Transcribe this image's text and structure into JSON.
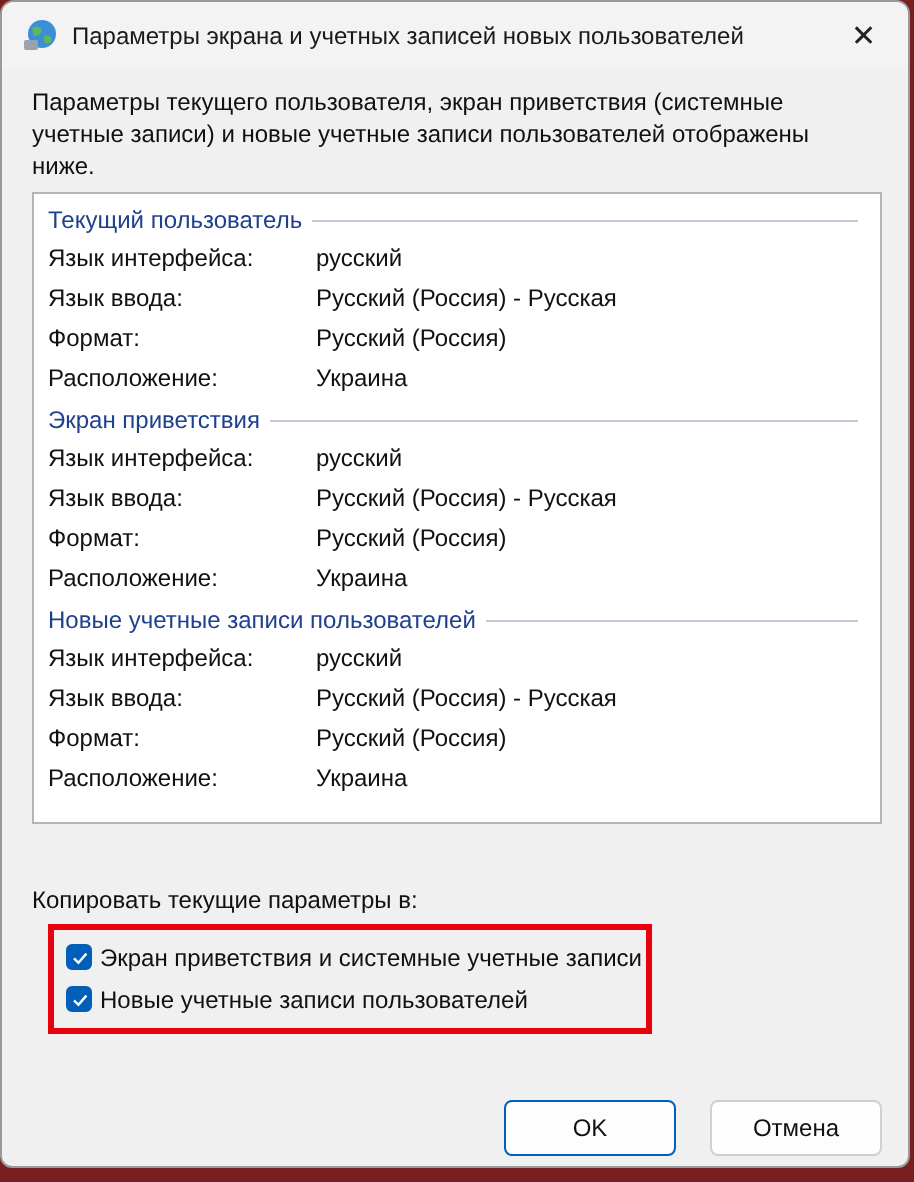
{
  "window": {
    "title": "Параметры экрана и учетных записей новых пользователей",
    "close": "✕"
  },
  "intro": "Параметры текущего пользователя, экран приветствия (системные учетные записи) и новые учетные записи пользователей отображены ниже.",
  "sections": [
    {
      "heading": "Текущий пользователь",
      "rows": [
        {
          "label": "Язык интерфейса:",
          "value": "русский"
        },
        {
          "label": "Язык ввода:",
          "value": "Русский (Россия) - Русская"
        },
        {
          "label": "Формат:",
          "value": "Русский (Россия)"
        },
        {
          "label": "Расположение:",
          "value": "Украина"
        }
      ]
    },
    {
      "heading": "Экран приветствия",
      "rows": [
        {
          "label": "Язык интерфейса:",
          "value": "русский"
        },
        {
          "label": "Язык ввода:",
          "value": "Русский (Россия) - Русская"
        },
        {
          "label": "Формат:",
          "value": "Русский (Россия)"
        },
        {
          "label": "Расположение:",
          "value": "Украина"
        }
      ]
    },
    {
      "heading": "Новые учетные записи пользователей",
      "rows": [
        {
          "label": "Язык интерфейса:",
          "value": "русский"
        },
        {
          "label": "Язык ввода:",
          "value": "Русский (Россия) - Русская"
        },
        {
          "label": "Формат:",
          "value": "Русский (Россия)"
        },
        {
          "label": "Расположение:",
          "value": "Украина"
        }
      ]
    }
  ],
  "copy_label": "Копировать текущие параметры в:",
  "options": [
    {
      "label": "Экран приветствия и системные учетные записи",
      "checked": true
    },
    {
      "label": "Новые учетные записи пользователей",
      "checked": true
    }
  ],
  "buttons": [
    {
      "label": "OK",
      "default": true
    },
    {
      "label": "Отмена",
      "default": false
    }
  ]
}
